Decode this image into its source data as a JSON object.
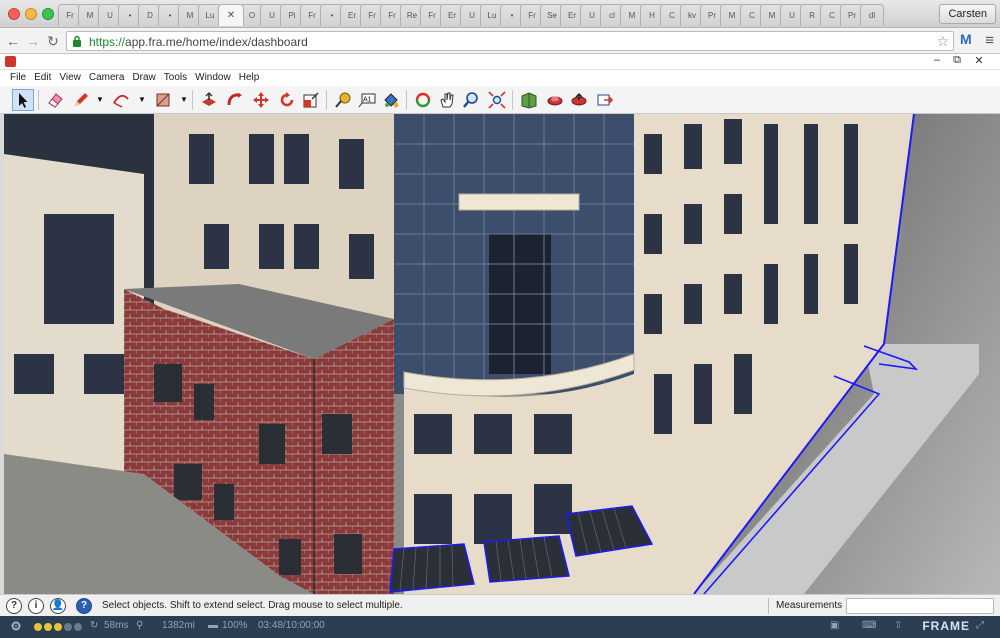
{
  "browser": {
    "tabs": [
      "Fr",
      "M",
      "U",
      "•",
      "D",
      "•",
      "M",
      "Lu",
      "✕",
      "O",
      "U",
      "Pi",
      "Fr",
      "•",
      "Er",
      "Fr",
      "Fr",
      "Re",
      "Fr",
      "Er",
      "U",
      "Lu",
      "•",
      "Fr",
      "Se",
      "Er",
      "U",
      "cl",
      "M",
      "H",
      "C",
      "kv",
      "Pr",
      "M",
      "C",
      "M",
      "U",
      "R",
      "C",
      "Pr",
      "dl"
    ],
    "active_tab_index": 8,
    "user_button": "Carsten",
    "url_proto": "https://",
    "url_rest": "app.fra.me/home/index/dashboard",
    "ext_label": "M"
  },
  "app": {
    "menus": [
      "File",
      "Edit",
      "View",
      "Camera",
      "Draw",
      "Tools",
      "Window",
      "Help"
    ],
    "tools": [
      {
        "name": "select-tool",
        "icon": "arrow-icon"
      },
      {
        "name": "eraser-tool",
        "icon": "eraser-icon"
      },
      {
        "name": "pencil-tool",
        "icon": "pencil-icon"
      },
      {
        "name": "arc-tool",
        "icon": "arc-icon"
      },
      {
        "name": "rectangle-tool",
        "icon": "rectangle-icon"
      },
      {
        "name": "push-pull-tool",
        "icon": "push-pull-icon"
      },
      {
        "name": "follow-me-tool",
        "icon": "follow-me-icon"
      },
      {
        "name": "move-tool",
        "icon": "move-icon"
      },
      {
        "name": "rotate-tool",
        "icon": "rotate-icon"
      },
      {
        "name": "scale-tool",
        "icon": "scale-icon"
      },
      {
        "name": "tape-measure-tool",
        "icon": "tape-measure-icon"
      },
      {
        "name": "text-tool",
        "icon": "text-icon"
      },
      {
        "name": "paint-bucket-tool",
        "icon": "paint-bucket-icon"
      },
      {
        "name": "orbit-tool",
        "icon": "orbit-icon"
      },
      {
        "name": "pan-tool",
        "icon": "hand-icon"
      },
      {
        "name": "zoom-tool",
        "icon": "zoom-icon"
      },
      {
        "name": "zoom-extents-tool",
        "icon": "zoom-extents-icon"
      },
      {
        "name": "3d-warehouse-tool",
        "icon": "warehouse-icon"
      },
      {
        "name": "extension-warehouse-tool",
        "icon": "extension-icon"
      },
      {
        "name": "share-model-tool",
        "icon": "share-icon"
      },
      {
        "name": "send-to-layout-tool",
        "icon": "layout-icon"
      }
    ],
    "text_tool_label": "A1",
    "status_icons": [
      "?",
      "i",
      "👤",
      "?"
    ],
    "status_text": "Select objects. Shift to extend select. Drag mouse to select multiple.",
    "measurements_label": "Measurements",
    "measurements_value": ""
  },
  "frame": {
    "ping": "58ms",
    "distance": "1382mi",
    "battery": "100%",
    "time": "03:48/10:00:00",
    "logo": "FRAME",
    "colors": {
      "bar": "#2b3e52",
      "dot_on": "#e7c33a",
      "dot_off": "#6b7a89"
    }
  }
}
